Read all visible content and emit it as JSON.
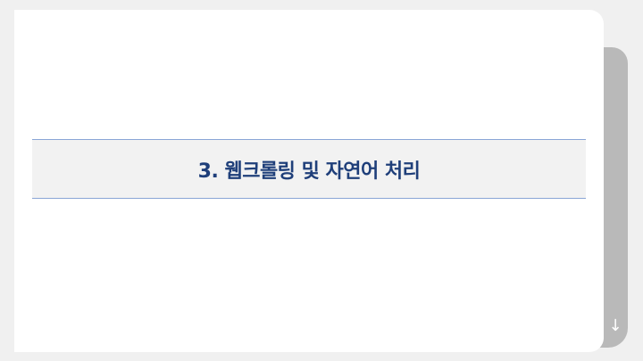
{
  "slide": {
    "title": "3. 웹크롤링 및 자연어 처리"
  },
  "controls": {
    "scroll_down_glyph": "↓",
    "scroll_down_icon": "arrow-down-icon"
  },
  "colors": {
    "background": "#f0f0f0",
    "slide": "#ffffff",
    "shadow": "#b9b9b9",
    "band": "#f2f2f2",
    "band_border": "#8aa6d6",
    "title": "#1f3f7a"
  }
}
